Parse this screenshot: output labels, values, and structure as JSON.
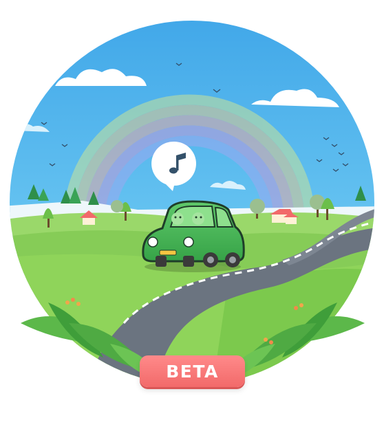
{
  "badge": {
    "label": "BETA",
    "color": "#f26a6a"
  },
  "illustration": {
    "icons": [
      "music-note-icon"
    ],
    "colors": {
      "sky": "#5bc0f0",
      "grass": "#8ed45a",
      "car": "#4fb85a",
      "road": "#6b7480",
      "badge": "#f26a6a"
    }
  }
}
